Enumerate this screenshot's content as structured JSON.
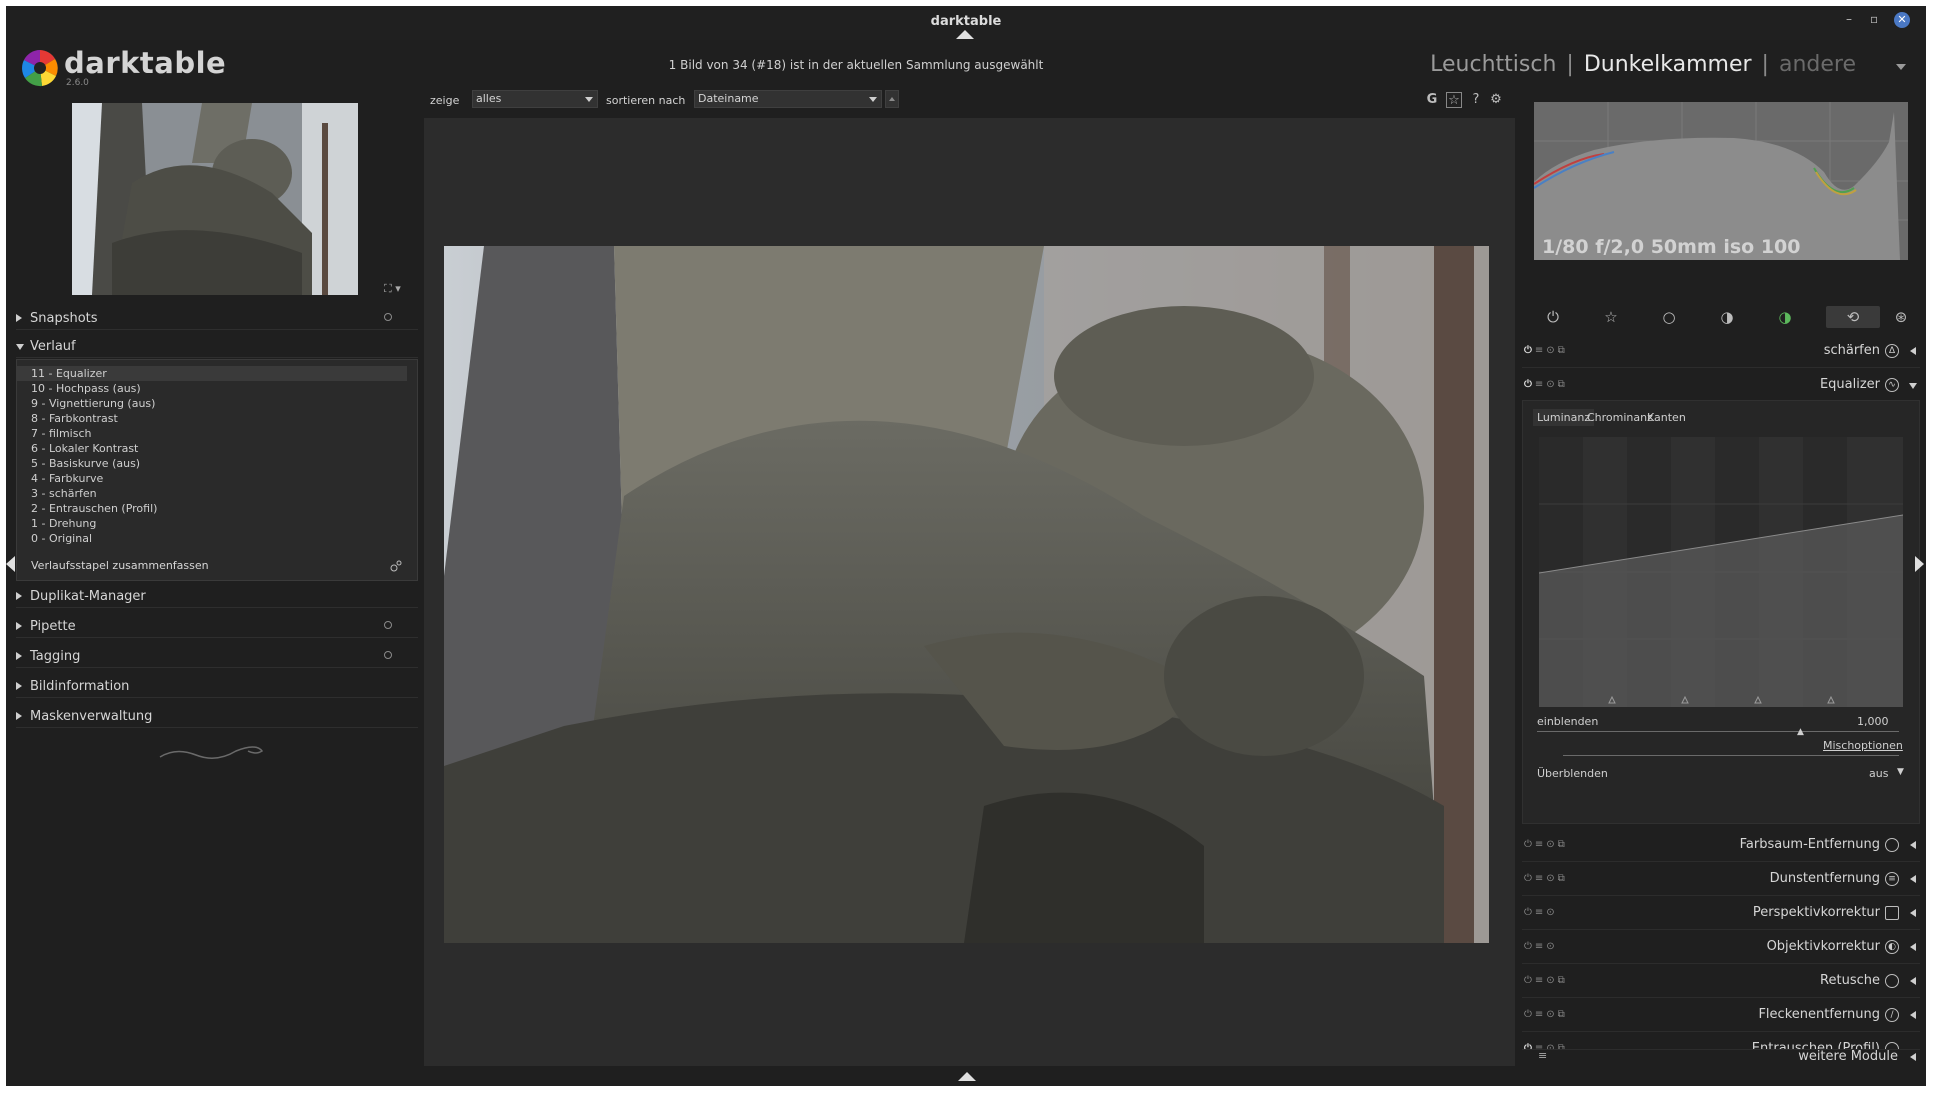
{
  "window": {
    "title": "darktable",
    "minimize": "–",
    "maximize": "▫",
    "close": "✕"
  },
  "app": {
    "name": "darktable",
    "version": "2.6.0"
  },
  "status": "1 Bild von 34 (#18) ist in der aktuellen Sammlung ausgewählt",
  "views": {
    "lighttable": "Leuchttisch",
    "darkroom": "Dunkelkammer",
    "other": "andere",
    "separator": "|"
  },
  "toolbar": {
    "show_label": "zeige",
    "show_value": "alles",
    "sort_label": "sortieren nach",
    "sort_value": "Dateiname",
    "icons": [
      "grouping-icon",
      "star-overlay-icon",
      "help-icon",
      "gear-icon"
    ],
    "icon_glyphs": {
      "grouping": "G",
      "star": "☆",
      "help": "?",
      "gear": "⚙"
    }
  },
  "left_panel": {
    "snapshots": "Snapshots",
    "history_title": "Verlauf",
    "history": [
      "11 - Equalizer",
      "10 - Hochpass (aus)",
      "9 - Vignettierung (aus)",
      "8 - Farbkontrast",
      "7 - filmisch",
      "6 - Lokaler Kontrast",
      "5 - Basiskurve (aus)",
      "4 - Farbkurve",
      "3 - schärfen",
      "2 - Entrauschen (Profil)",
      "1 - Drehung",
      "0 - Original"
    ],
    "compress": "Verlaufsstapel zusammenfassen",
    "sections": [
      "Duplikat-Manager",
      "Pipette",
      "Tagging",
      "Bildinformation",
      "Maskenverwaltung"
    ]
  },
  "right_panel": {
    "exif": "1/80 f/2,0 50mm iso 100",
    "modules_top": [
      {
        "name": "schärfen",
        "icon": "sharpen-icon",
        "expanded": false
      },
      {
        "name": "Equalizer",
        "icon": "equalizer-icon",
        "expanded": true
      }
    ],
    "equalizer": {
      "tabs": [
        "Luminanz",
        "Chrominanz",
        "Kanten"
      ],
      "mix_label": "einblenden",
      "mix_value": "1,000",
      "blend_options": "Mischoptionen",
      "blend_label": "Überblenden",
      "blend_value": "aus"
    },
    "modules_bottom": [
      {
        "name": "Farbsaum-Entfernung",
        "icon": "defringe-icon"
      },
      {
        "name": "Dunstentfernung",
        "icon": "haze-removal-icon"
      },
      {
        "name": "Perspektivkorrektur",
        "icon": "perspective-icon"
      },
      {
        "name": "Objektivkorrektur",
        "icon": "lens-icon"
      },
      {
        "name": "Retusche",
        "icon": "retouch-icon"
      },
      {
        "name": "Fleckenentfernung",
        "icon": "spot-removal-icon"
      },
      {
        "name": "Entrauschen (Profil)",
        "icon": "denoise-icon"
      }
    ],
    "more_modules": "weitere Module"
  }
}
